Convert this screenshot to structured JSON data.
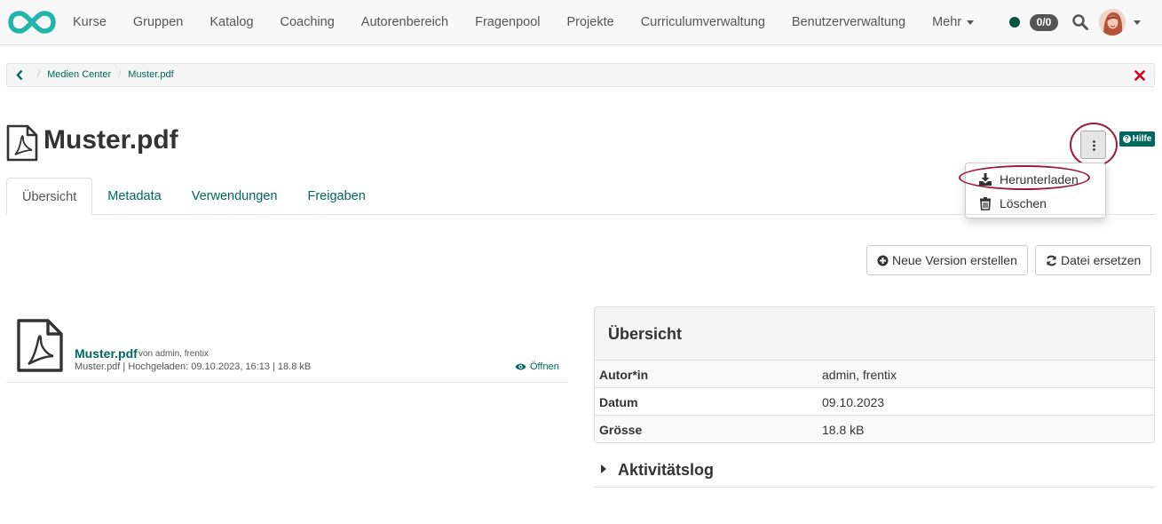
{
  "nav": {
    "items": [
      {
        "label": "Kurse"
      },
      {
        "label": "Gruppen"
      },
      {
        "label": "Katalog"
      },
      {
        "label": "Coaching"
      },
      {
        "label": "Autorenbereich"
      },
      {
        "label": "Fragenpool"
      },
      {
        "label": "Projekte"
      },
      {
        "label": "Curriculumverwaltung"
      },
      {
        "label": "Benutzerverwaltung"
      }
    ],
    "more_label": "Mehr",
    "counter": "0/0",
    "status_color": "#00573b",
    "search_icon": "search-icon"
  },
  "breadcrumb": {
    "items": [
      "Medien Center",
      "Muster.pdf"
    ]
  },
  "page": {
    "title": "Muster.pdf",
    "help_label": "Hilfe"
  },
  "dropdown": {
    "download_label": "Herunterladen",
    "delete_label": "Löschen"
  },
  "tabs": [
    {
      "label": "Übersicht",
      "active": true
    },
    {
      "label": "Metadata"
    },
    {
      "label": "Verwendungen"
    },
    {
      "label": "Freigaben"
    }
  ],
  "actions": {
    "new_version_label": "Neue Version erstellen",
    "replace_label": "Datei ersetzen"
  },
  "file": {
    "name": "Muster.pdf",
    "by": "von admin, frentix",
    "meta": "Muster.pdf | Hochgeladen: 09.10.2023, 16:13 | 18.8 kB",
    "open_label": "Öffnen"
  },
  "overview": {
    "title": "Übersicht",
    "rows": [
      {
        "label": "Autor*in",
        "value": "admin, frentix"
      },
      {
        "label": "Datum",
        "value": "09.10.2023"
      },
      {
        "label": "Grösse",
        "value": "18.8 kB"
      }
    ]
  },
  "activity": {
    "label": "Aktivitätslog"
  },
  "colors": {
    "accent": "#00685e",
    "highlight": "#9b1c3a",
    "close": "#d0021b"
  }
}
